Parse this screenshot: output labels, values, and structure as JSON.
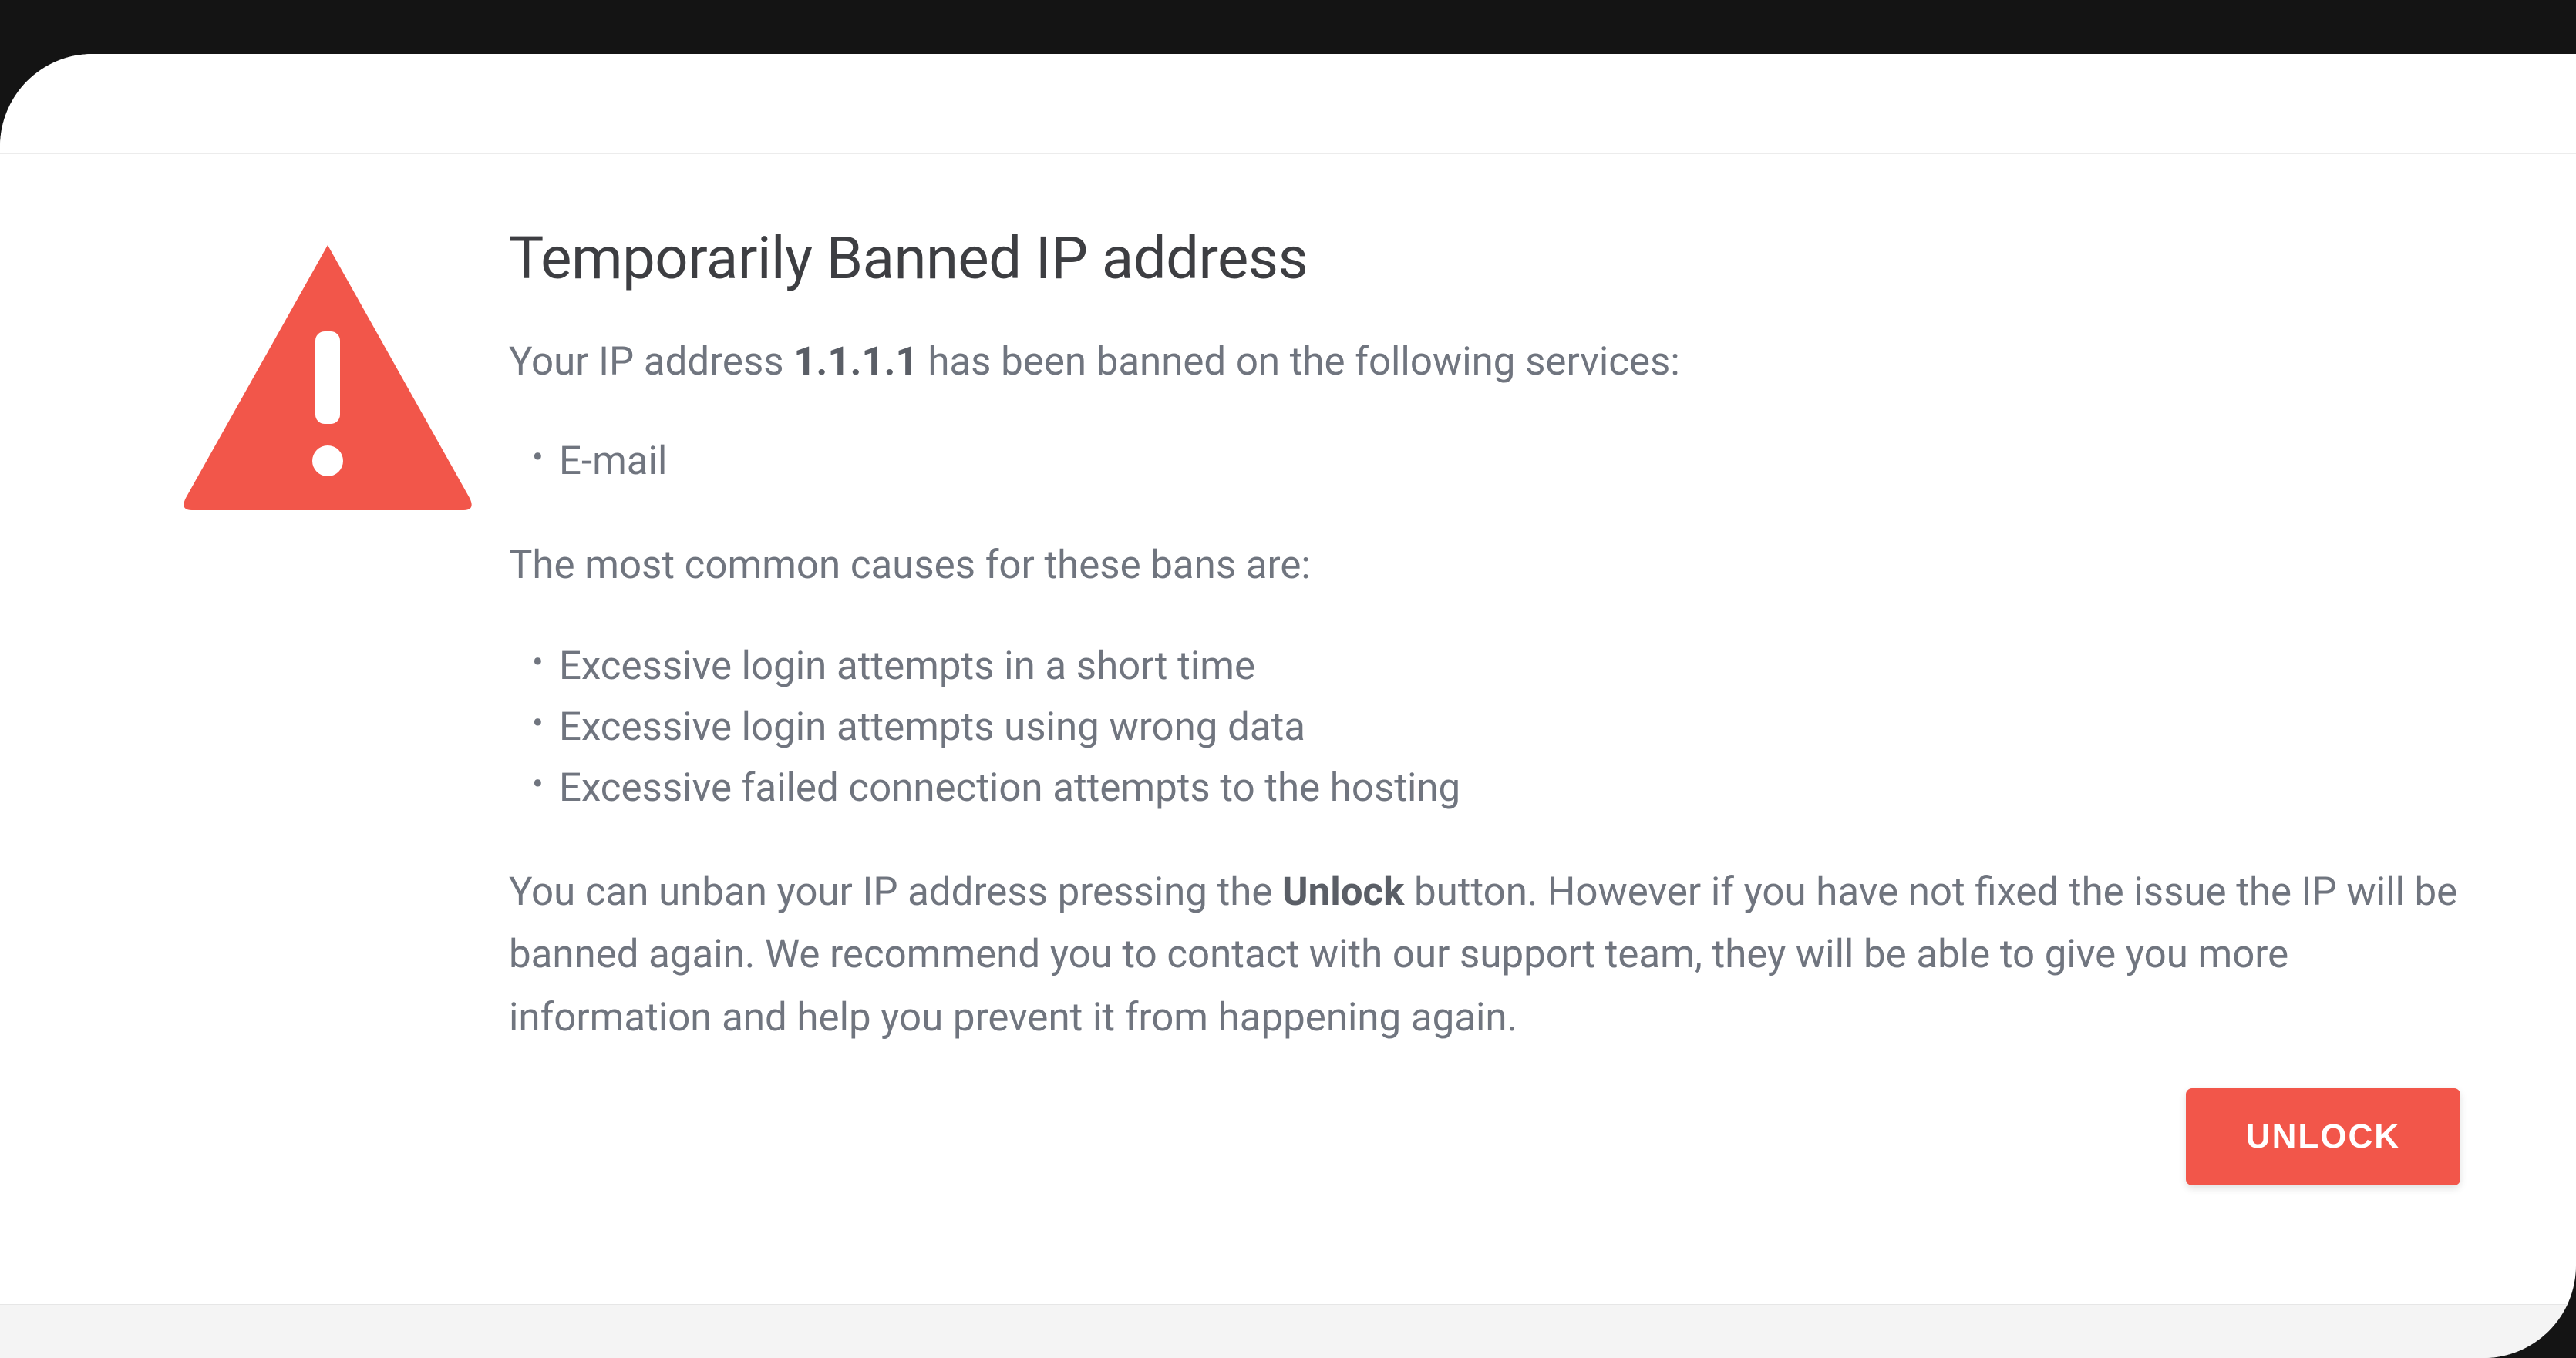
{
  "title": "Temporarily Banned IP address",
  "intro_prefix": "Your IP address ",
  "ip_address": "1.1.1.1",
  "intro_suffix": " has been banned on the following services:",
  "services": [
    "E-mail"
  ],
  "causes_intro": "The most common causes for these bans are:",
  "causes": [
    "Excessive login attempts in a short time",
    "Excessive login attempts using wrong data",
    "Excessive failed connection attempts to the hosting"
  ],
  "explanation_prefix": "You can unban your IP address pressing the ",
  "unlock_word": "Unlock",
  "explanation_suffix": " button. However if you have not fixed the issue the IP will be banned again. We recommend you to contact with our support team, they will be able to give you more information and help you prevent it from happening again.",
  "unlock_button": "UNLOCK",
  "colors": {
    "danger": "#f2564a",
    "text_muted": "#70757f",
    "heading": "#3d3e42"
  }
}
